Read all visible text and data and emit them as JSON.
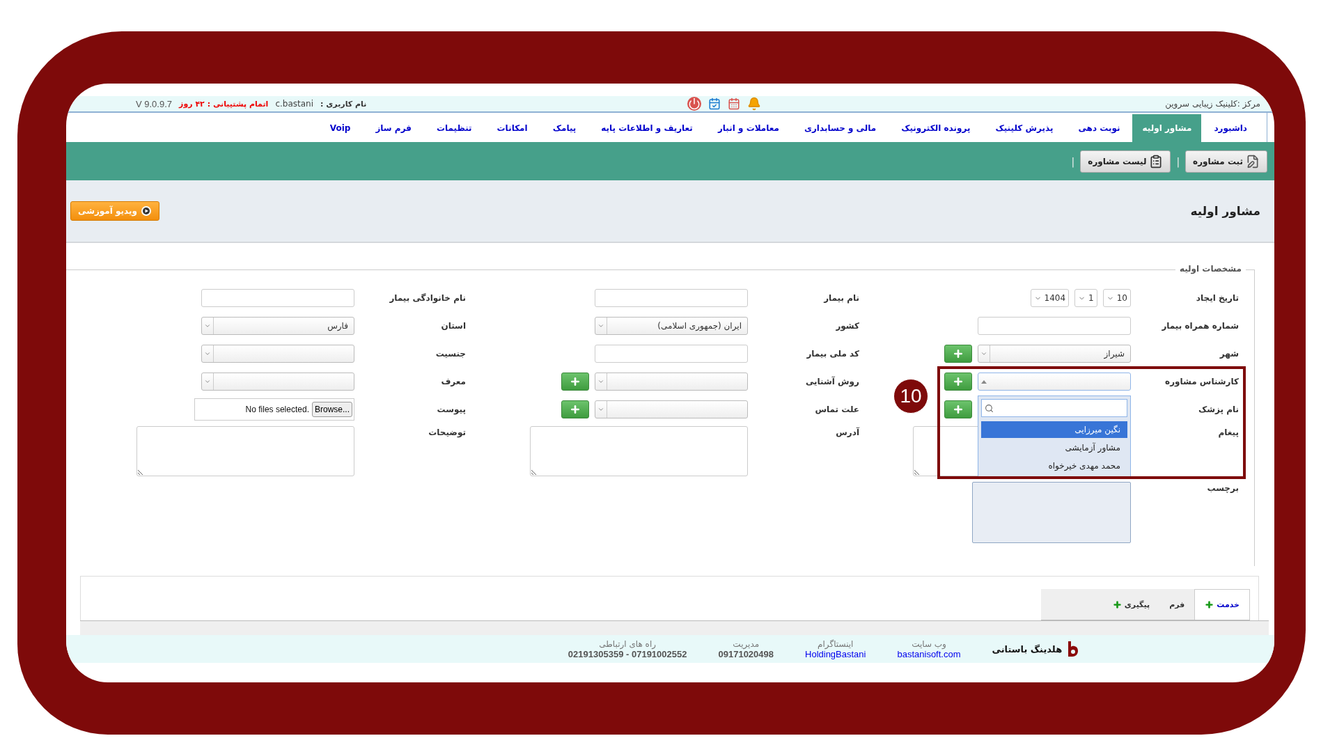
{
  "top_bar": {
    "center": "مرکز :کلینیک زیبایی سروین",
    "username_label": "نام کاربری :",
    "username": "c.bastani",
    "support": "اتمام پشتیبانی : ۴۲ روز",
    "version": "V 9.0.9.7"
  },
  "nav": [
    {
      "label": "داشبورد",
      "selected": false
    },
    {
      "label": "مشاور اولیه",
      "selected": true
    },
    {
      "label": "نوبت دهی",
      "selected": false
    },
    {
      "label": "پذیرش کلینیک",
      "selected": false
    },
    {
      "label": "پرونده الکترونیک",
      "selected": false
    },
    {
      "label": "مالی و حسابداری",
      "selected": false
    },
    {
      "label": "معاملات و انبار",
      "selected": false
    },
    {
      "label": "تعاریف و اطلاعات پایه",
      "selected": false
    },
    {
      "label": "پیامک",
      "selected": false
    },
    {
      "label": "امکانات",
      "selected": false
    },
    {
      "label": "تنظیمات",
      "selected": false
    },
    {
      "label": "فرم ساز",
      "selected": false
    },
    {
      "label": "Voip",
      "selected": false
    }
  ],
  "toolbar": [
    {
      "label": "ثبت مشاوره",
      "kind": "register"
    },
    {
      "label": "لیست مشاوره",
      "kind": "list"
    }
  ],
  "toolbar_separator": "|",
  "page_title": "مشاور اولیه",
  "video_button": "ویدیو آموزشی",
  "section_title": "مشخصات اولیه",
  "rows": [
    [
      {
        "label": "تاریخ ایجاد",
        "kind": "date",
        "parts": [
          "10",
          "1",
          "1404"
        ]
      },
      {
        "label": "نام بیمار",
        "kind": "input"
      },
      {
        "label": "نام خانوادگی بیمار",
        "kind": "input"
      }
    ],
    [
      {
        "label": "شماره همراه بیمار",
        "kind": "input"
      },
      {
        "label": "کشور",
        "kind": "select",
        "value": "ایران (جمهوری اسلامی)"
      },
      {
        "label": "استان",
        "kind": "select",
        "value": "فارس"
      }
    ],
    [
      {
        "label": "شهر",
        "kind": "select",
        "value": "شیراز",
        "add": true
      },
      {
        "label": "کد ملی بیمار",
        "kind": "input"
      },
      {
        "label": "جنسیت",
        "kind": "select"
      }
    ],
    [
      {
        "label": "کارشناس مشاوره",
        "kind": "combo",
        "add": true,
        "options": [
          {
            "label": "نگین میرزایی",
            "selected": true
          },
          {
            "label": "مشاور آزمایشی",
            "selected": false
          },
          {
            "label": "محمد مهدی خیرخواه",
            "selected": false
          }
        ]
      },
      {
        "label": "روش آشنایی",
        "kind": "select",
        "add": true
      },
      {
        "label": "معرف",
        "kind": "select"
      }
    ],
    [
      {
        "label": "نام پزشک",
        "kind": "covered",
        "add": true
      },
      {
        "label": "علت تماس",
        "kind": "select",
        "add": true
      },
      {
        "label": "پیوست",
        "kind": "file",
        "button": "Browse...",
        "value": "No files selected."
      }
    ],
    [
      {
        "label": "پیغام",
        "kind": "textarea"
      },
      {
        "label": "آدرس",
        "kind": "textarea"
      },
      {
        "label": "توضیحات",
        "kind": "textarea"
      }
    ],
    [
      {
        "label": "برچسب",
        "kind": "tags"
      }
    ]
  ],
  "annotation": {
    "number": "10"
  },
  "bottom_tabs": [
    {
      "label": "خدمت",
      "add": true,
      "selected": true
    },
    {
      "label": "فرم",
      "add": false,
      "selected": false
    },
    {
      "label": "پیگیری",
      "add": true,
      "selected": false
    }
  ],
  "footer": {
    "brand": "هلدینگ باستانی",
    "items": [
      {
        "title": "وب سایت",
        "value": "bastanisoft.com",
        "link": true
      },
      {
        "title": "اینستاگرام",
        "value": "HoldingBastani",
        "link": true
      },
      {
        "title": "مدیریت",
        "value": "09171020498",
        "link": false
      },
      {
        "title": "راه های ارتباطی",
        "value": "07191002552 - 02191305359",
        "link": false
      }
    ]
  }
}
